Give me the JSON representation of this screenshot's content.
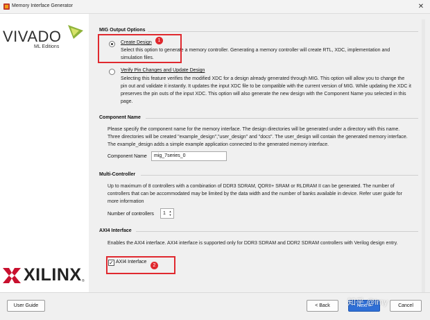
{
  "window": {
    "title": "Memory Interface Generator",
    "close_symbol": "✕"
  },
  "branding": {
    "vivado": "VIVADO",
    "vivado_sub": "ML Editions",
    "xilinx": "XILINX",
    "xilinx_reg": "®"
  },
  "mig_output_options": {
    "title": "MIG Output Options",
    "create_design": {
      "label": "Create Design",
      "selected": true,
      "description": "Select this option to generate a memory controller. Generating a memory controller will create RTL, XDC, implementation and simulation files."
    },
    "verify_pin_changes": {
      "label": "Verify Pin Changes and Update Design",
      "selected": false,
      "description": "Selecting this feature verifies the modified XDC for a design already generated through MIG. This option will allow you to change the pin out and validate it instantly. It updates the input XDC file to be compatible with the current version of MIG. While updating the XDC it preserves the pin outs of the input XDC. This option will also generate the new design with the Component Name you selected in this page."
    }
  },
  "component_name": {
    "title": "Component Name",
    "description": "Please specify the component name for the memory interface. The design directories will be generated under a directory with this name. Three directories will be created \"example_design\",\"user_design\" and \"docs\". The user_design will contain the generated memory interface. The example_design adds a simple example application connected to the generated memory interface.",
    "field_label": "Component Name",
    "value": "mig_7series_0"
  },
  "multi_controller": {
    "title": "Multi-Controller",
    "description": "Up to maximum of 8 controllers with a combination of DDR3 SDRAM, QDRII+ SRAM or RLDRAM II can be generated. The number of controllers that can be accommodated may be limited by the data width and the number of banks available in device. Refer user guide for more information",
    "field_label": "Number of controllers",
    "value": "1"
  },
  "axi4_interface": {
    "title": "AXI4 Interface",
    "description": "Enables the AXI4 interface. AXI4 interface is supported only for DDR3 SDRAM and DDR2 SDRAM controllers with Verilog design entry.",
    "checkbox_label": "AXI4 Interface",
    "checked": true
  },
  "annotations": {
    "marker_1": "1",
    "marker_2": "2",
    "color": "#e0282e"
  },
  "footer": {
    "user_guide": "User Guide",
    "back": "< Back",
    "next": "Next >",
    "cancel": "Cancel",
    "watermark": "知乎 @lmy"
  },
  "colors": {
    "primary_button": "#2f6fd6",
    "vivado_mark_green": "#8fb33a",
    "xilinx_red": "#c8102e"
  }
}
